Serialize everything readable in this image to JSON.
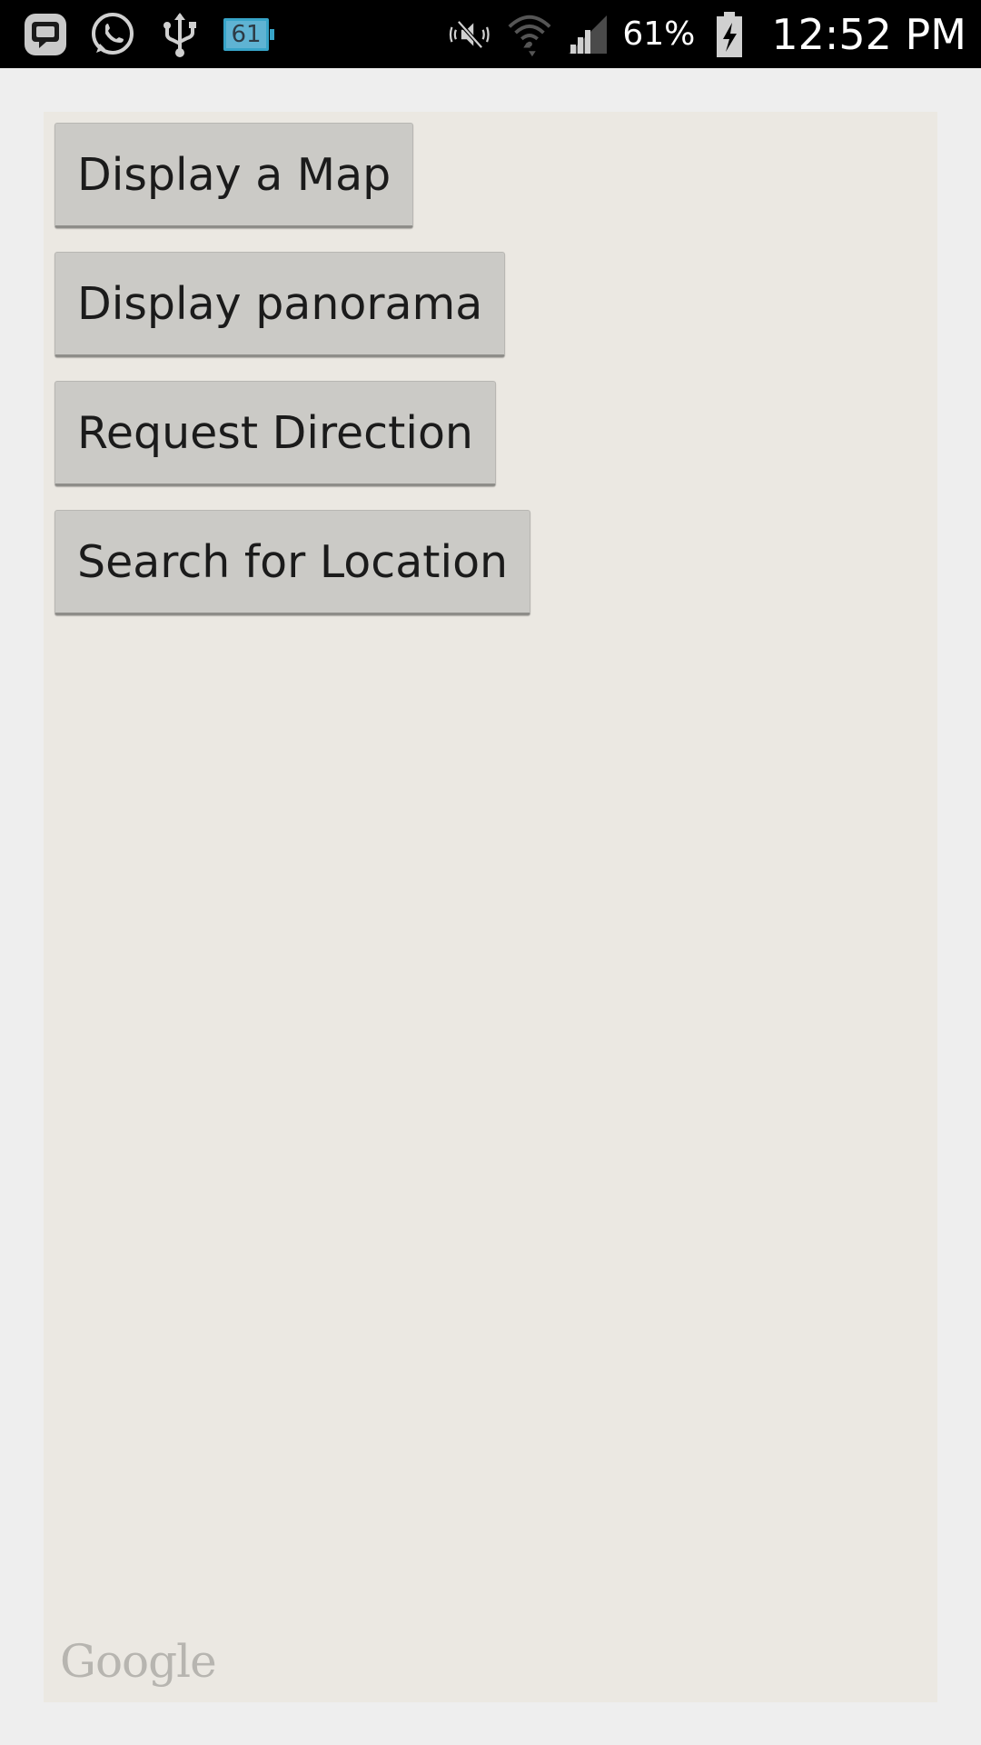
{
  "status_bar": {
    "left_icons": [
      "bbm-icon",
      "whatsapp-icon",
      "usb-icon",
      "battery-notification-icon"
    ],
    "battery_badge": "61",
    "right_icons": [
      "nfc-mute-icon",
      "wifi-icon",
      "signal-icon",
      "battery-charging-icon"
    ],
    "battery_percent": "61%",
    "time": "12:52 PM"
  },
  "buttons": {
    "display_map": "Display a Map",
    "display_panorama": "Display panorama",
    "request_direction": "Request Direction",
    "search_location": "Search for Location"
  },
  "map": {
    "attribution": "Google"
  },
  "colors": {
    "status_bar_bg": "#000000",
    "page_bg": "#eeeeee",
    "map_bg": "#ebe8e2",
    "button_bg": "#cbcac6"
  }
}
